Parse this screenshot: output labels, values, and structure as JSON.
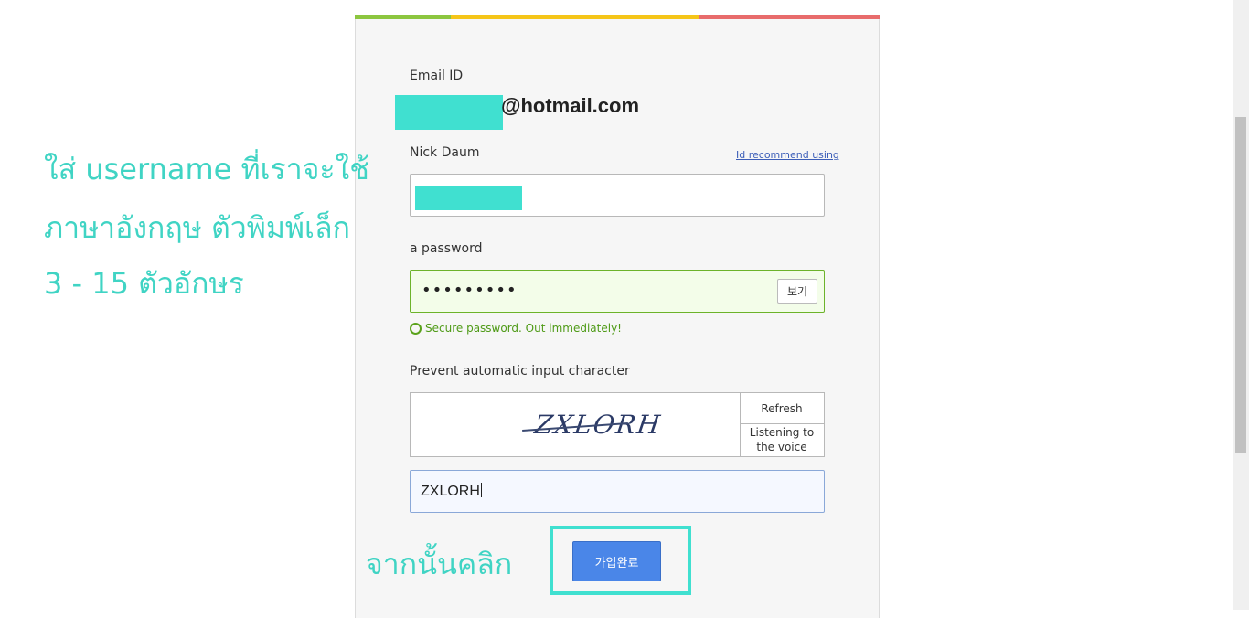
{
  "form": {
    "email_label": "Email ID",
    "email_domain": "@hotmail.com",
    "nick_label": "Nick Daum",
    "id_recommend_link": "Id recommend using",
    "password_label": "a password",
    "password_masked": "•••••••••",
    "show_button": "보기",
    "password_status": "Secure password. Out immediately!",
    "captcha_label": "Prevent automatic input character",
    "captcha_image_text": "ZXLORH",
    "refresh_button": "Refresh",
    "listen_button": "Listening to the voice",
    "captcha_input_value": "ZXLORH",
    "submit_button": "가입완료"
  },
  "annotations": {
    "line1": "ใส่ username ที่เราจะใช้",
    "line2": "ภาษาอังกฤษ ตัวพิมพ์เล็ก",
    "line3": "3 - 15 ตัวอักษร",
    "click_hint": "จากนั้นคลิก"
  },
  "colors": {
    "annotation": "#40e0d0",
    "topbar": [
      "#8cc63f",
      "#f5c518",
      "#e86c6c"
    ],
    "submit": "#4a86e8",
    "password_ok": "#5aa21b"
  }
}
